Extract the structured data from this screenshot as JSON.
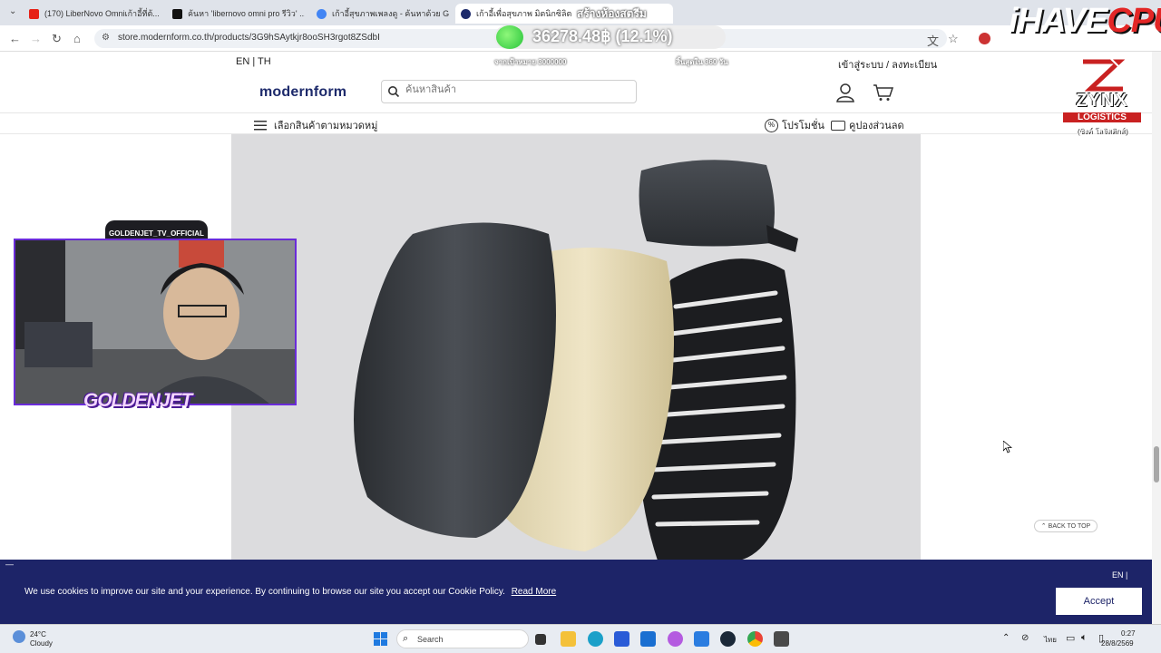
{
  "browser": {
    "tabs": [
      {
        "title": "(170) LiberNovo Omniเก้าอี้ที่ต้...",
        "icon": "youtube-icon",
        "color": "#e62117"
      },
      {
        "title": "ค้นหา 'libernovo omni pro รีวิว' ...",
        "icon": "tiktok-icon",
        "color": "#111111"
      },
      {
        "title": "เก้าอี้สุขภาพเพลงดู - ค้นหาด้วย Goo...",
        "icon": "google-icon",
        "color": "#4285f4"
      },
      {
        "title": "เก้าอี้เพื่อสุขภาพ มิตนิกซิลิตร รุ่น...",
        "icon": "modernform-icon",
        "color": "#1d2a6b"
      }
    ],
    "url": "store.modernform.co.th/products/3G9hSAytkjr8ooSH3rgot8ZSdbI"
  },
  "overlays": {
    "stream_badge": "สร้างห้องสตรีม",
    "ticker_value": "36278.48฿ (12.1%)",
    "goal_left": "จากเป้าหมาย 3000000",
    "goal_right": "สิ้นสุดใน 360 วัน",
    "ihave": "iHAVE",
    "cpu": "CPU",
    "zynx_line1": "ZYNX",
    "zynx_line2": "LOGISTICS",
    "zynx_line3": "(ซิงค์ โลจิสติกส์)",
    "cam_handle": "GOLDENJET_TV_OFFICIAL",
    "cam_label": "GOLDENJET"
  },
  "site": {
    "lang": "EN | TH",
    "account": "เข้าสู่ระบบ / ลงทะเบียน",
    "logo": "modernform",
    "search_placeholder": "ค้นหาสินค้า",
    "category_menu": "เลือกสินค้าตามหมวดหมู่",
    "promotion": "โปรโมชั่น",
    "coupon": "คูปองส่วนลด",
    "back_to_top": "BACK TO TOP"
  },
  "cookie": {
    "lang": "EN",
    "message": "We use cookies to improve our site and your experience. By continuing to browse our site you accept our Cookie Policy.",
    "read_more": "Read More",
    "accept": "Accept"
  },
  "taskbar": {
    "temp": "24°C",
    "weather": "Cloudy",
    "search": "Search",
    "lang": "ไทย",
    "time": "0:27",
    "date": "28/8/2569"
  }
}
